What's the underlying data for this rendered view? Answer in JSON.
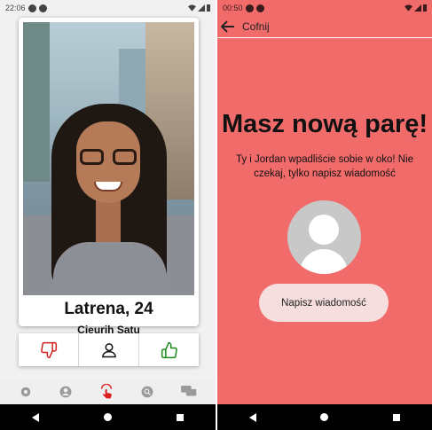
{
  "left": {
    "status": {
      "time": "22:06"
    },
    "profile": {
      "name": "Latrena, 24",
      "subtitle": "Cieurih Satu"
    },
    "actions": [
      {
        "icon": "thumbs-down-icon",
        "color": "#d22020"
      },
      {
        "icon": "person-icon",
        "color": "#111111"
      },
      {
        "icon": "thumbs-up-icon",
        "color": "#1a8a1a"
      }
    ],
    "bottom_nav": [
      "gear-icon",
      "account-icon",
      "swipe-icon",
      "search-icon",
      "chat-icon"
    ],
    "active_nav_color": "#e01b1b"
  },
  "right": {
    "status": {
      "time": "00:50"
    },
    "topbar": {
      "back_label": "Cofnij"
    },
    "match": {
      "title": "Masz nową parę!",
      "description": "Ty i Jordan wpadliście sobie w oko! Nie czekaj, tylko napisz wiadomość"
    },
    "button": {
      "label": "Napisz wiadomość"
    },
    "background_color": "#f26b6b"
  }
}
